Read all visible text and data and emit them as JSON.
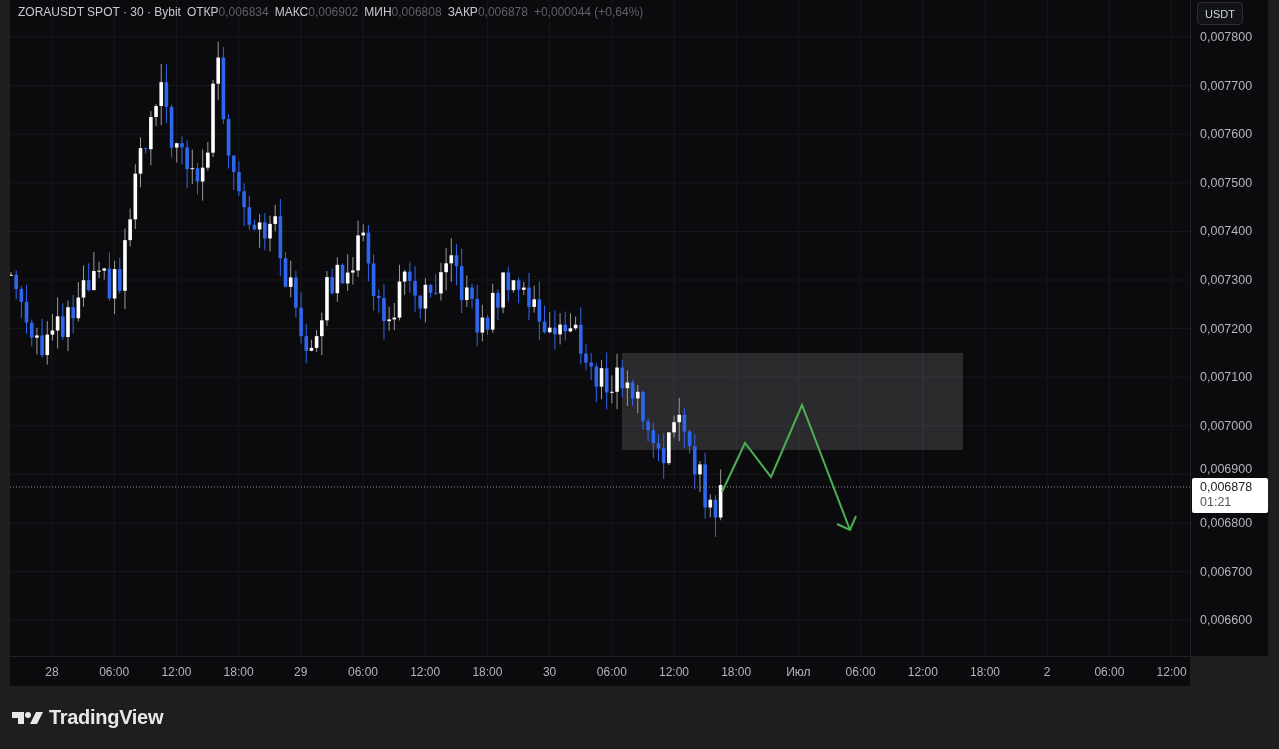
{
  "header": {
    "symbol": "ZORAUSDT SPOT · 30 · Bybit",
    "fields": [
      {
        "label": "ОТКР",
        "value": "0,006834"
      },
      {
        "label": "МАКС",
        "value": "0,006902"
      },
      {
        "label": "МИН",
        "value": "0,006808"
      },
      {
        "label": "ЗАКР",
        "value": "0,006878"
      }
    ],
    "change": "+0,000044 (+0,64%)"
  },
  "currency_button": "USDT",
  "price_axis": {
    "ticks": [
      "0,007800",
      "0,007700",
      "0,007600",
      "0,007500",
      "0,007400",
      "0,007300",
      "0,007200",
      "0,007100",
      "0,007000",
      "0,006900",
      "0,006800",
      "0,006700",
      "0,006600"
    ],
    "last_price": "0,006878",
    "countdown": "01:21"
  },
  "time_axis": {
    "labels": [
      "28",
      "06:00",
      "12:00",
      "18:00",
      "29",
      "06:00",
      "12:00",
      "18:00",
      "30",
      "06:00",
      "12:00",
      "18:00",
      "Июл",
      "06:00",
      "12:00",
      "18:00",
      "2",
      "06:00",
      "12:00"
    ]
  },
  "footer": {
    "brand": "TradingView"
  }
}
